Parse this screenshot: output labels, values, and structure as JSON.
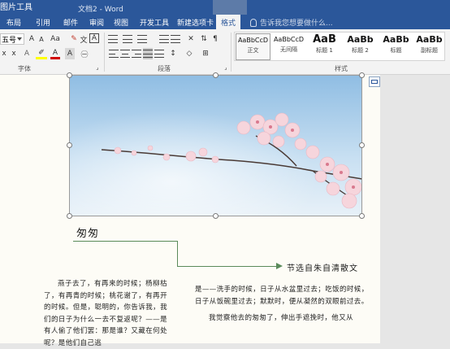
{
  "window": {
    "title": "文档2 - Word",
    "context_tool_label": "图片工具"
  },
  "tabs": [
    {
      "label": "布局"
    },
    {
      "label": "引用"
    },
    {
      "label": "邮件"
    },
    {
      "label": "审阅"
    },
    {
      "label": "视图"
    },
    {
      "label": "开发工具"
    },
    {
      "label": "新建选项卡"
    },
    {
      "label": "格式",
      "active": true
    }
  ],
  "tell_me": {
    "placeholder": "告诉我您想要做什么..."
  },
  "ribbon": {
    "font_size": "五号",
    "groups": {
      "font": "字体",
      "paragraph": "段落",
      "styles": "样式"
    },
    "font_buttons": [
      "A",
      "A",
      "Aa",
      "A",
      "x",
      "x",
      "A",
      "A"
    ],
    "styles_gallery": [
      {
        "sample": "AaBbCcD",
        "name": "正文",
        "selected": true
      },
      {
        "sample": "AaBbCcD",
        "name": "无间隔"
      },
      {
        "sample": "AaB",
        "name": "标题 1"
      },
      {
        "sample": "AaBb",
        "name": "标题 2"
      },
      {
        "sample": "AaBb",
        "name": "标题"
      },
      {
        "sample": "AaBb",
        "name": "副标题"
      }
    ]
  },
  "document": {
    "heading": "匆匆",
    "subtitle": "节选自朱自清散文",
    "left_column": "燕子去了，有再来的时候；杨柳枯了，有再青的时候；桃花谢了，有再开的时候。但是，聪明的，你告诉我，我们的日子为什么一去不复返呢？——是有人偷了他们罢：那是谁？又藏在何处呢？是他们自己逃",
    "right_column_p1": "是——洗手的时候，日子从水盆里过去；吃饭的时候，日子从饭碗里过去；默默时，便从凝然的双眼前过去。",
    "right_column_p2": "我觉察他去的匆匆了，伸出手遮挽时，他又从"
  },
  "colors": {
    "word_blue": "#2b579a",
    "callout_green": "#5a8a5a",
    "page_bg": "#fdfcf6"
  }
}
